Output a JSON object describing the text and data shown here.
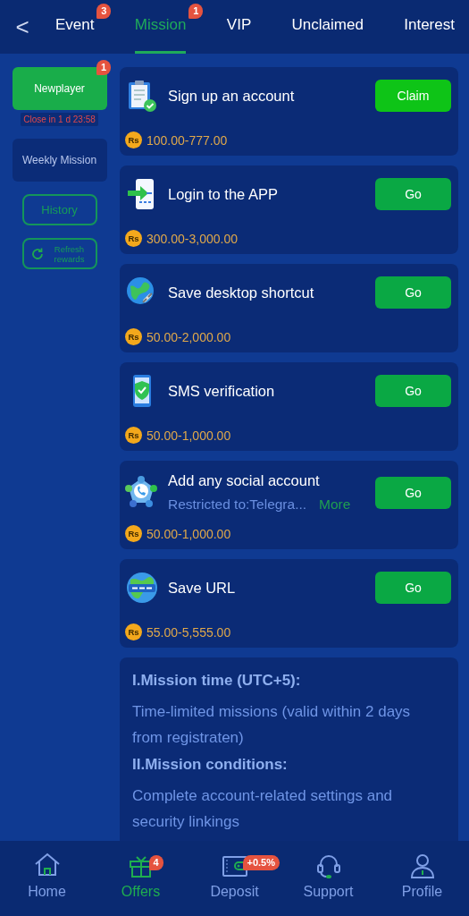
{
  "header": {
    "back": "<",
    "tabs": [
      {
        "label": "Event",
        "selected": false,
        "badge": "3"
      },
      {
        "label": "Mission",
        "selected": true,
        "badge": "1"
      },
      {
        "label": "VIP",
        "selected": false
      },
      {
        "label": "Unclaimed",
        "selected": false
      },
      {
        "label": "Interest",
        "selected": false
      }
    ]
  },
  "sidebar": {
    "items": [
      {
        "label": "Newplayer",
        "selected": true,
        "badge": "1",
        "countdown": "Close in 1 d 23:58"
      },
      {
        "label": "Weekly Mission",
        "selected": false
      }
    ],
    "buttons": [
      {
        "label": "History",
        "kind": "plain"
      },
      {
        "label": "Refresh rewards",
        "kind": "refresh"
      }
    ]
  },
  "tasks": [
    {
      "title": "Sign up an account",
      "amount": "100.00-777.00",
      "currency": "Rs",
      "button": {
        "label": "Claim",
        "kind": "claim"
      }
    },
    {
      "title": "Login to the APP",
      "amount": "300.00-3,000.00",
      "currency": "Rs",
      "button": {
        "label": "Go",
        "kind": "go"
      }
    },
    {
      "title": "Save desktop shortcut",
      "amount": "50.00-2,000.00",
      "currency": "Rs",
      "button": {
        "label": "Go",
        "kind": "go"
      }
    },
    {
      "title": "SMS verification",
      "amount": "50.00-1,000.00",
      "currency": "Rs",
      "button": {
        "label": "Go",
        "kind": "go"
      }
    },
    {
      "title": "Add any social account",
      "restriction": "Restricted to:Telegra...",
      "more": "More",
      "amount": "50.00-1,000.00",
      "currency": "Rs",
      "button": {
        "label": "Go",
        "kind": "go"
      }
    },
    {
      "title": "Save URL",
      "amount": "55.00-5,555.00",
      "currency": "Rs",
      "button": {
        "label": "Go",
        "kind": "go"
      }
    }
  ],
  "rules": [
    {
      "kind": "heading",
      "text": "I.Mission time (UTC+5):"
    },
    {
      "kind": "text",
      "text": "Time-limited missions (valid within 2 days from registraten)"
    },
    {
      "kind": "heading",
      "text": "II.Mission conditions:"
    },
    {
      "kind": "text",
      "text": "Complete account-related settings and security linkings"
    }
  ],
  "bottom_nav": [
    {
      "label": "Home",
      "selected": false
    },
    {
      "label": "Offers",
      "selected": true,
      "badge": "4"
    },
    {
      "label": "Deposit",
      "selected": false,
      "badge": "+0.5%"
    },
    {
      "label": "Support",
      "selected": false
    },
    {
      "label": "Profile",
      "selected": false
    }
  ]
}
